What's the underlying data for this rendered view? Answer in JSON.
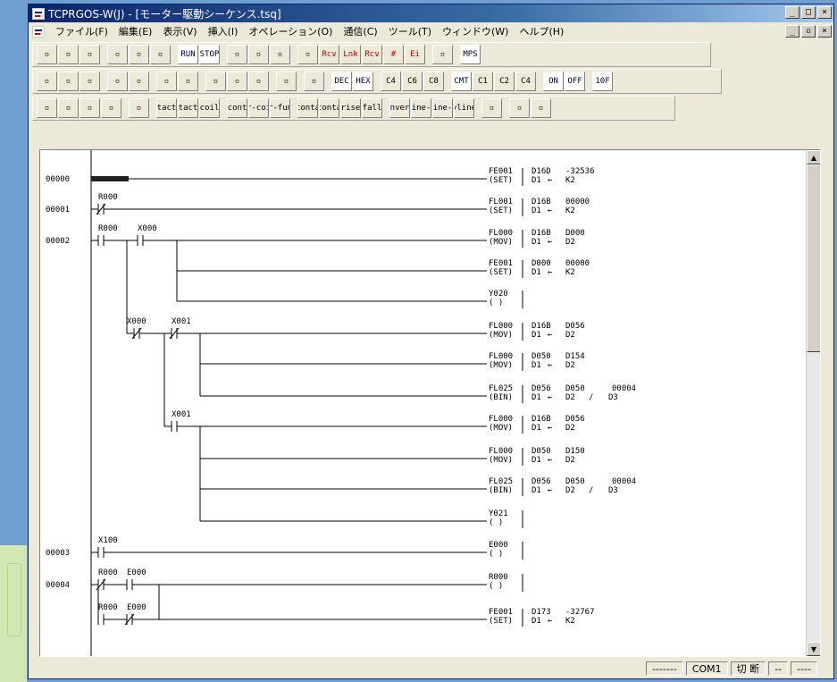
{
  "window": {
    "title": "TCPRGOS-W(J) - [モーター駆動シーケンス.tsq]",
    "min": "_",
    "max": "□",
    "close": "×",
    "restore": "▫"
  },
  "menu": [
    "ファイル(F)",
    "編集(E)",
    "表示(V)",
    "挿入(I)",
    "オペレーション(O)",
    "通信(C)",
    "ツール(T)",
    "ウィンドウ(W)",
    "ヘルプ(H)"
  ],
  "toolbar1": [
    "new-icon",
    "open-icon",
    "edit-icon",
    "",
    "transfer-icon",
    "compare-icon",
    "print-preview-icon",
    "",
    "RUN",
    "STOP",
    "",
    "flash-icon",
    "flash-off-icon",
    "write-icon",
    "",
    "comment-icon",
    "Rcv",
    "Lnk",
    "Rcv",
    "#",
    "Ei",
    "",
    "help-icon",
    "",
    "MPS"
  ],
  "toolbar2": [
    "insert-icon",
    "col-icon",
    "row-icon",
    "",
    "zoom-icon",
    "fe-icon",
    "",
    "print-icon",
    "preview-icon",
    "",
    "binoculars-icon",
    "find-up-icon",
    "find-down-icon",
    "",
    "replace-icon",
    "",
    "list-icon",
    "",
    "DEC",
    "HEX",
    "",
    "C4",
    "C6",
    "C8",
    "",
    "CMT",
    "C1",
    "C2",
    "C4",
    "",
    "ON",
    "OFF",
    "",
    "10F"
  ],
  "toolbar3": [
    "save-icon",
    "cut-icon",
    "copy-icon",
    "paste-icon",
    "",
    "pencil-icon",
    "",
    "contact-no",
    "contact-nc",
    "coil",
    "",
    "or-contact",
    "or-coil",
    "or-func",
    "",
    "a-contact",
    "b-contact",
    "rise",
    "fall",
    "",
    "invert",
    "line-h",
    "line-v",
    "vline",
    "",
    "delete-icon",
    "",
    "refresh-icon",
    "grid-icon"
  ],
  "rungs": [
    {
      "num": "00000"
    },
    {
      "num": "00001"
    },
    {
      "num": "00002"
    },
    {
      "num": "00003"
    },
    {
      "num": "00004"
    }
  ],
  "ladder": {
    "labels": {
      "r1c": "R000",
      "r2a": "R000",
      "r2b": "X000",
      "b2a": "X000",
      "b2b": "X001",
      "b3": "X001",
      "r3": "X100",
      "r4a": "R000",
      "r4b": "E000",
      "r5a": "R000",
      "r5b": "E000"
    },
    "instr": [
      {
        "op": "FE001",
        "fn": "(SET)",
        "a1": "D16D",
        "a2": "-32536",
        "b1": "D1",
        "b2": "K2"
      },
      {
        "op": "FL001",
        "fn": "(SET)",
        "a1": "D16B",
        "a2": "00000",
        "b1": "D1",
        "b2": "K2"
      },
      {
        "op": "FL000",
        "fn": "(MOV)",
        "a1": "D16B",
        "a2": "D000",
        "b1": "D1",
        "b2": "D2"
      },
      {
        "op": "FE001",
        "fn": "(SET)",
        "a1": "D000",
        "a2": "00000",
        "b1": "D1",
        "b2": "K2"
      },
      {
        "op": "Y020",
        "fn": "(   )"
      },
      {
        "op": "FL000",
        "fn": "(MOV)",
        "a1": "D16B",
        "a2": "D056",
        "b1": "D1",
        "b2": "D2"
      },
      {
        "op": "FL000",
        "fn": "(MOV)",
        "a1": "D050",
        "a2": "D154",
        "b1": "D1",
        "b2": "D2"
      },
      {
        "op": "FL025",
        "fn": "(BIN)",
        "a1": "D056",
        "a2": "D050",
        "a3": "00004",
        "b1": "D1",
        "b2": "D2",
        "b3": "D3"
      },
      {
        "op": "FL000",
        "fn": "(MOV)",
        "a1": "D16B",
        "a2": "D056",
        "b1": "D1",
        "b2": "D2"
      },
      {
        "op": "FL000",
        "fn": "(MOV)",
        "a1": "D050",
        "a2": "D150",
        "b1": "D1",
        "b2": "D2"
      },
      {
        "op": "FL025",
        "fn": "(BIN)",
        "a1": "D056",
        "a2": "D050",
        "a3": "00004",
        "b1": "D1",
        "b2": "D2",
        "b3": "D3"
      },
      {
        "op": "Y021",
        "fn": "(   )"
      },
      {
        "op": "E000",
        "fn": "(   )"
      },
      {
        "op": "R000",
        "fn": "(   )"
      },
      {
        "op": "FE001",
        "fn": "(SET)",
        "a1": "D173",
        "a2": "-32767",
        "b1": "D1",
        "b2": "K2"
      }
    ],
    "arrow": "←",
    "slash": "/"
  },
  "status": {
    "s1": "-------",
    "s2": "COM1",
    "s3": "切 断",
    "s4": "--",
    "s5": "----"
  },
  "scroll": {
    "up": "▲",
    "down": "▼"
  }
}
